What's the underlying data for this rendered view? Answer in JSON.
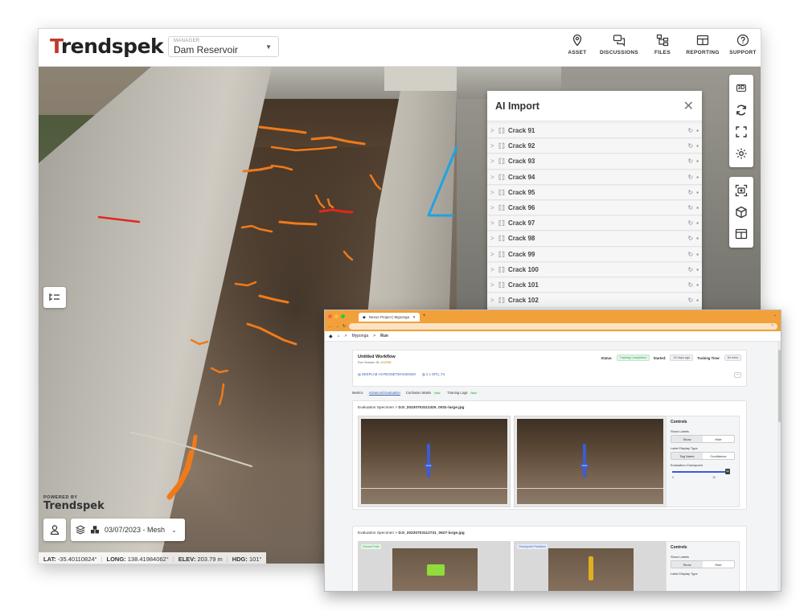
{
  "app": {
    "logo_pre": "T",
    "logo_text": "rendspek",
    "manager_label": "MANAGER",
    "manager_value": "Dam Reservoir",
    "nav": [
      {
        "label": "ASSET",
        "icon": "location-pin-icon"
      },
      {
        "label": "DISCUSSIONS",
        "icon": "chat-bubbles-icon"
      },
      {
        "label": "FILES",
        "icon": "folder-tree-icon"
      },
      {
        "label": "REPORTING",
        "icon": "table-grid-icon"
      },
      {
        "label": "SUPPORT",
        "icon": "help-circle-icon"
      }
    ]
  },
  "viewer": {
    "powered_by": "POWERED BY",
    "powered_logo": "Trendspek",
    "mesh_label": "03/07/2023 - Mesh",
    "coords": {
      "lat_k": "LAT:",
      "lat_v": "-35.40110824°",
      "long_k": "LONG:",
      "long_v": "138.41984062°",
      "elev_k": "ELEV:",
      "elev_v": "203.79 m",
      "hdg_k": "HDG:",
      "hdg_v": "101°"
    },
    "tools_top": [
      {
        "icon": "3d-view-icon",
        "text": "3D"
      },
      {
        "icon": "refresh-icon"
      },
      {
        "icon": "fullscreen-icon"
      },
      {
        "icon": "settings-gear-icon"
      }
    ],
    "tools_bottom": [
      {
        "icon": "camera-capture-icon"
      },
      {
        "icon": "cube-icon"
      },
      {
        "icon": "split-view-icon"
      }
    ],
    "colors": {
      "crack_orange": "#f07a1a",
      "crack_red": "#e0281a",
      "selection_blue": "#1fa3e0"
    }
  },
  "ai_import": {
    "title": "AI Import",
    "items": [
      "Crack 91",
      "Crack 92",
      "Crack 93",
      "Crack 94",
      "Crack 95",
      "Crack 96",
      "Crack 97",
      "Crack 98",
      "Crack 99",
      "Crack 100",
      "Crack 101",
      "Crack 102"
    ]
  },
  "browser": {
    "tab_title": "Nexus Project | Myponga",
    "breadcrumb": [
      "Myponga",
      "Run"
    ],
    "workflow_title": "Untitled Workflow",
    "session_label": "Run Session ID:",
    "session_id": "#0293B",
    "model_tag": "DEEPLAB V3-RESNET50-640X640",
    "gpu_tag": "2 x GPU_T4",
    "status_label": "Status:",
    "status_value": "Training Completed",
    "started_label": "Started:",
    "started_value": "20 days ago",
    "training_time_label": "Training Time:",
    "training_time_value": "64 mins",
    "more_label": "...",
    "tabs": [
      "Metrics",
      "Advanced Evaluation",
      "Confusion Matrix",
      "Training Logs"
    ],
    "new_badge": "New",
    "specimen1": {
      "label": "Evaluation Specimen",
      "file": "DJI_20230703111325_0031-large.jpg"
    },
    "specimen2": {
      "label": "Evaluation Specimen",
      "file": "DJI_20230703112731_0627-large.jpg"
    },
    "mark_label": "Crack",
    "ground_truth": "Ground Truth",
    "checkpoint_prediction": "Checkpoint Prediction",
    "controls": {
      "title": "Controls",
      "show_labels": "Show Labels",
      "show": "Show",
      "hide": "Hide",
      "label_display_type": "Label Display Type",
      "tag_name": "Tag Name",
      "confidence": "Confidence",
      "eval_checkpoint": "Evaluation Checkpoint",
      "tick_min": "0",
      "tick_mid": "10",
      "value": "20"
    }
  }
}
